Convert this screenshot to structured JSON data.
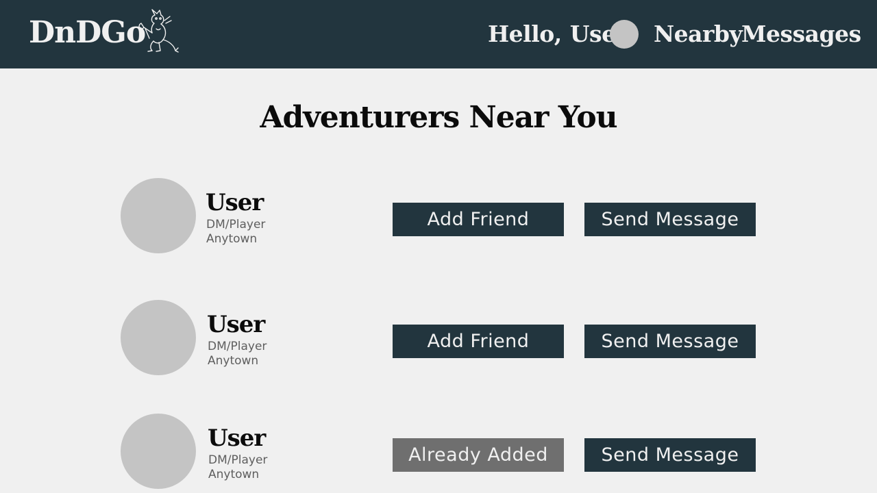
{
  "header": {
    "logo_text": "DnDGo",
    "logo_art": "dragon-mascot",
    "greeting": "Hello,",
    "username": "User",
    "nav": [
      {
        "label": "Nearby"
      },
      {
        "label": "Messages"
      }
    ]
  },
  "main": {
    "title": "Adventurers Near You",
    "adventurers": [
      {
        "name": "User",
        "role": "DM/Player",
        "town": "Anytown",
        "friend_label": "Add Friend",
        "message_label": "Send Message",
        "friend_status": "not-added"
      },
      {
        "name": "User",
        "role": "DM/Player",
        "town": "Anytown",
        "friend_label": "Add Friend",
        "message_label": "Send Message",
        "friend_status": "not-added"
      },
      {
        "name": "User",
        "role": "DM/Player",
        "town": "Anytown",
        "friend_label": "Already Added",
        "message_label": "Send Message",
        "friend_status": "added"
      }
    ]
  },
  "colors": {
    "header_bg": "#22353e",
    "page_bg": "#f0f0f0",
    "button_bg": "#22353e",
    "button_disabled_bg": "#6f6f6f",
    "avatar_placeholder": "#c4c4c4"
  }
}
